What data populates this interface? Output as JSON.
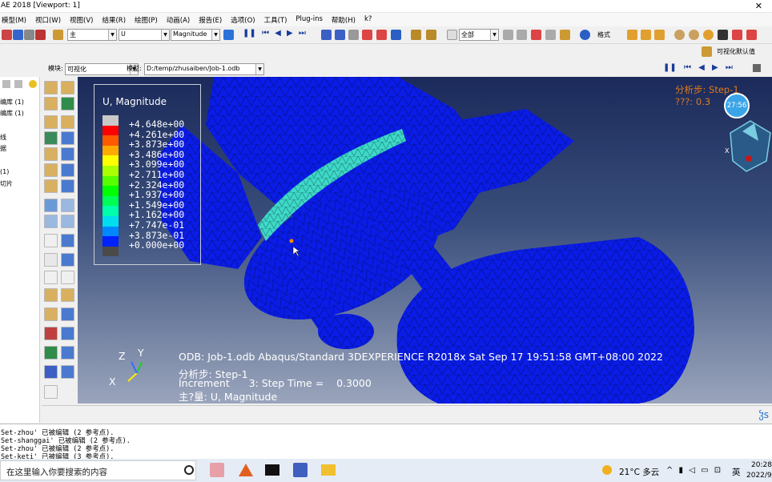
{
  "window": {
    "title": "AE 2018 [Viewport: 1]"
  },
  "menu": [
    "模型(M)",
    "视口(W)",
    "视图(V)",
    "结果(R)",
    "绘图(P)",
    "动画(A)",
    "报告(E)",
    "选项(O)",
    "工具(T)",
    "Plug-ins",
    "帮助(H)",
    "k?"
  ],
  "toolbar": {
    "combo_part": "主",
    "combo_var": "U",
    "combo_invariant": "Magnitude",
    "combo_selection": "全部",
    "combo_style": "格式",
    "viz_default": "可视化默认值"
  },
  "context": {
    "module_label": "模块:",
    "module_value": "可视化",
    "model_label": "模型:",
    "model_value": "D:/temp/zhusaiben/Job-1.odb"
  },
  "tree": {
    "items": [
      "编库 (1)",
      "编库 (1)",
      "线",
      "据",
      "(1)",
      "切片"
    ]
  },
  "legend": {
    "title": "U, Magnitude",
    "entries": [
      "+4.648e+00",
      "+4.261e+00",
      "+3.873e+00",
      "+3.486e+00",
      "+3.099e+00",
      "+2.711e+00",
      "+2.324e+00",
      "+1.937e+00",
      "+1.549e+00",
      "+1.162e+00",
      "+7.747e-01",
      "+3.873e-01",
      "+0.000e+00"
    ],
    "colors": [
      "#c8c8c8",
      "#ff0000",
      "#ff5a00",
      "#ffaa00",
      "#ffff00",
      "#aaff00",
      "#55ff00",
      "#00ff00",
      "#00ff55",
      "#00ffaa",
      "#00ddee",
      "#0088ff",
      "#0022ff",
      "#4a4a4a"
    ]
  },
  "viewport": {
    "step_label": "分析步: Step-1",
    "step_sub": "???: 0.3",
    "timer": "27:56",
    "axis_labels": {
      "z": "Z",
      "y": "Y",
      "x": "X"
    },
    "odb_line": "ODB: Job-1.odb    Abaqus/Standard 3DEXPERIENCE R2018x    Sat Sep 17 19:51:58 GMT+08:00 2022",
    "step_line": "分析步: Step-1",
    "increment_line": "Increment      3: Step Time =    0.3000",
    "var_line": "主?量: U, Magnitude",
    "mesh_color": "#0a1ce6",
    "highlight_color": "#3ed8c8"
  },
  "messages": [
    "Set-zhou' 已被编辑 (2 参考点).",
    "Set-shanggai' 已被编辑 (2 参考点).",
    "Set-zhou' 已被编辑 (2 参考点).",
    "Set-keti' 已被编辑 (3 参考点)."
  ],
  "taskbar": {
    "search_placeholder": "在这里输入你要搜索的内容",
    "weather": "21°C 多云",
    "lang": "英",
    "time": "20:28",
    "date": "2022/9/"
  }
}
